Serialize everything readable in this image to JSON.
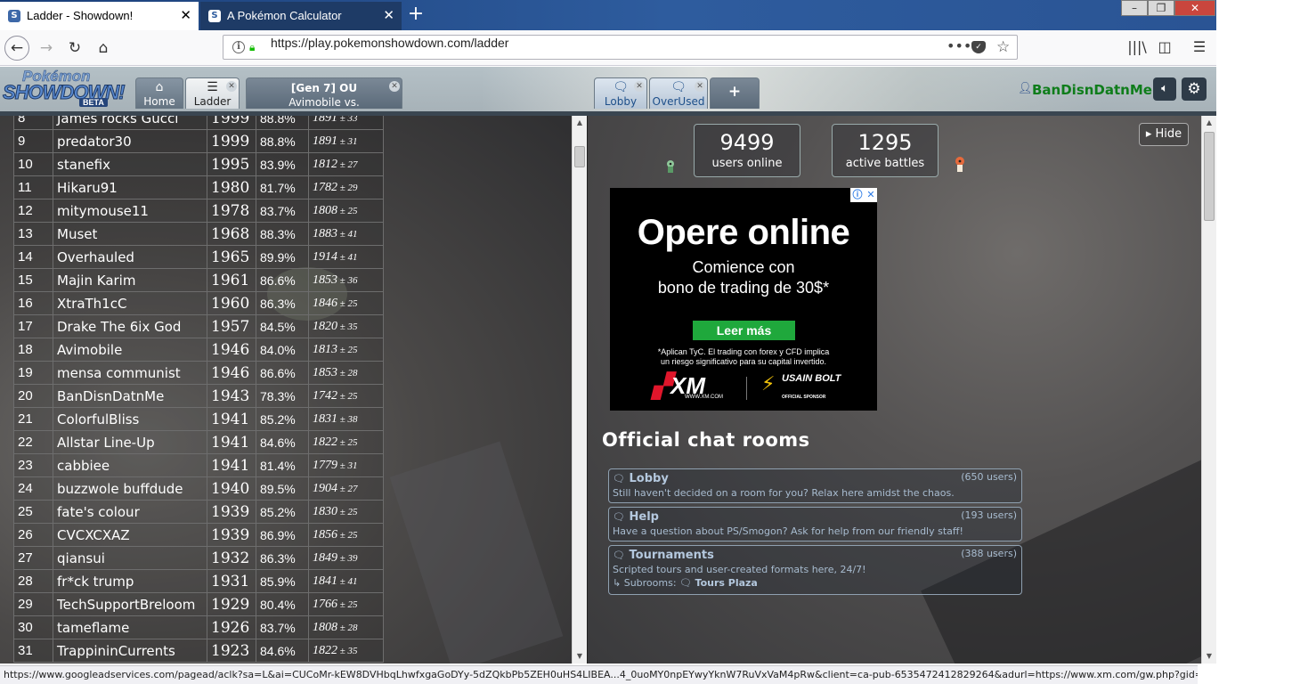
{
  "browser": {
    "tabs": [
      {
        "title": "Ladder - Showdown!",
        "active": true
      },
      {
        "title": "A Pokémon Calculator",
        "active": false
      }
    ],
    "url": "https://play.pokemonshowdown.com/ladder",
    "status_url": "https://www.googleadservices.com/pagead/aclk?sa=L&ai=CUCoMr-kEW8DVHbqLhwfxgaGoDYy-5dZQkbPb5ZEH0uHS4LIBEA...4_0uoMY0npEYwyYknW7RuVxVaM4pRw&client=ca-pub-6535472412829264&adurl=https://www.xm.com/gw.php?gid=42750"
  },
  "showdown": {
    "logo": {
      "line1": "Pokémon",
      "line2": "SHOWDOWN!",
      "badge": "BETA"
    },
    "tabs": {
      "home": "Home",
      "ladder": "Ladder",
      "battle_format": "[Gen 7] OU",
      "battle_players": "Avimobile vs. BanDisnDatnMe",
      "lobby": "Lobby",
      "overused": "OverUsed",
      "new": "+"
    },
    "username": "BanDisnDatnMe"
  },
  "ladder": {
    "rows": [
      {
        "rank": "8",
        "name": "James rocks Gucci",
        "elo": "1999",
        "gxe": "88.8%",
        "glicko": "1891",
        "dev": "33"
      },
      {
        "rank": "9",
        "name": "predator30",
        "elo": "1999",
        "gxe": "88.8%",
        "glicko": "1891",
        "dev": "31"
      },
      {
        "rank": "10",
        "name": "stanefix",
        "elo": "1995",
        "gxe": "83.9%",
        "glicko": "1812",
        "dev": "27"
      },
      {
        "rank": "11",
        "name": "Hikaru91",
        "elo": "1980",
        "gxe": "81.7%",
        "glicko": "1782",
        "dev": "29"
      },
      {
        "rank": "12",
        "name": "mitymouse11",
        "elo": "1978",
        "gxe": "83.7%",
        "glicko": "1808",
        "dev": "25"
      },
      {
        "rank": "13",
        "name": "Muset",
        "elo": "1968",
        "gxe": "88.3%",
        "glicko": "1883",
        "dev": "41"
      },
      {
        "rank": "14",
        "name": "Overhauled",
        "elo": "1965",
        "gxe": "89.9%",
        "glicko": "1914",
        "dev": "41"
      },
      {
        "rank": "15",
        "name": "Majin Karim",
        "elo": "1961",
        "gxe": "86.6%",
        "glicko": "1853",
        "dev": "36"
      },
      {
        "rank": "16",
        "name": "XtraTh1cC",
        "elo": "1960",
        "gxe": "86.3%",
        "glicko": "1846",
        "dev": "25"
      },
      {
        "rank": "17",
        "name": "Drake The 6ix God",
        "elo": "1957",
        "gxe": "84.5%",
        "glicko": "1820",
        "dev": "35"
      },
      {
        "rank": "18",
        "name": "Avimobile",
        "elo": "1946",
        "gxe": "84.0%",
        "glicko": "1813",
        "dev": "25"
      },
      {
        "rank": "19",
        "name": "mensa communist",
        "elo": "1946",
        "gxe": "86.6%",
        "glicko": "1853",
        "dev": "28"
      },
      {
        "rank": "20",
        "name": "BanDisnDatnMe",
        "elo": "1943",
        "gxe": "78.3%",
        "glicko": "1742",
        "dev": "25"
      },
      {
        "rank": "21",
        "name": "ColorfulBliss",
        "elo": "1941",
        "gxe": "85.2%",
        "glicko": "1831",
        "dev": "38"
      },
      {
        "rank": "22",
        "name": "Allstar Line-Up",
        "elo": "1941",
        "gxe": "84.6%",
        "glicko": "1822",
        "dev": "25"
      },
      {
        "rank": "23",
        "name": "cabbiee",
        "elo": "1941",
        "gxe": "81.4%",
        "glicko": "1779",
        "dev": "31"
      },
      {
        "rank": "24",
        "name": "buzzwole buffdude",
        "elo": "1940",
        "gxe": "89.5%",
        "glicko": "1904",
        "dev": "27"
      },
      {
        "rank": "25",
        "name": "fate's colour",
        "elo": "1939",
        "gxe": "85.2%",
        "glicko": "1830",
        "dev": "25"
      },
      {
        "rank": "26",
        "name": "CVCXCXAZ",
        "elo": "1939",
        "gxe": "86.9%",
        "glicko": "1856",
        "dev": "25"
      },
      {
        "rank": "27",
        "name": "qiansui",
        "elo": "1932",
        "gxe": "86.3%",
        "glicko": "1849",
        "dev": "39"
      },
      {
        "rank": "28",
        "name": "fr*ck trump",
        "elo": "1931",
        "gxe": "85.9%",
        "glicko": "1841",
        "dev": "41"
      },
      {
        "rank": "29",
        "name": "TechSupportBreloom",
        "elo": "1929",
        "gxe": "80.4%",
        "glicko": "1766",
        "dev": "25"
      },
      {
        "rank": "30",
        "name": "tameflame",
        "elo": "1926",
        "gxe": "83.7%",
        "glicko": "1808",
        "dev": "28"
      },
      {
        "rank": "31",
        "name": "TrappininCurrents",
        "elo": "1923",
        "gxe": "84.6%",
        "glicko": "1822",
        "dev": "35"
      }
    ]
  },
  "main": {
    "hide_label": "Hide",
    "users_online_count": "9499",
    "users_online_label": "users online",
    "active_battles_count": "1295",
    "active_battles_label": "active battles",
    "ad": {
      "title": "Opere online",
      "line1": "Comience con",
      "line2": "bono de trading de 30$*",
      "cta": "Leer más",
      "disclaimer1": "*Aplican TyC. El trading con forex y CFD implica",
      "disclaimer2": "un riesgo significativo para su capital invertido.",
      "brand": "XM",
      "brand_site": "WWW.XM.COM",
      "partner": "USAIN BOLT",
      "partner_note": "OFFICIAL SPONSOR"
    },
    "official_title": "Official chat rooms",
    "rooms": [
      {
        "name": "Lobby",
        "users": "(650 users)",
        "desc": "Still haven't decided on a room for you? Relax here amidst the chaos."
      },
      {
        "name": "Help",
        "users": "(193 users)",
        "desc": "Have a question about PS/Smogon? Ask for help from our friendly staff!"
      },
      {
        "name": "Tournaments",
        "users": "(388 users)",
        "desc": "Scripted tours and user-created formats here, 24/7!",
        "subrooms_label": "Subrooms:",
        "subroom": "Tours Plaza"
      }
    ]
  },
  "colors": {
    "username": "#0f7d1b",
    "ad_cta": "#1fa83c",
    "xm_red": "#e0162b",
    "room_text": "#a8bcd0"
  }
}
